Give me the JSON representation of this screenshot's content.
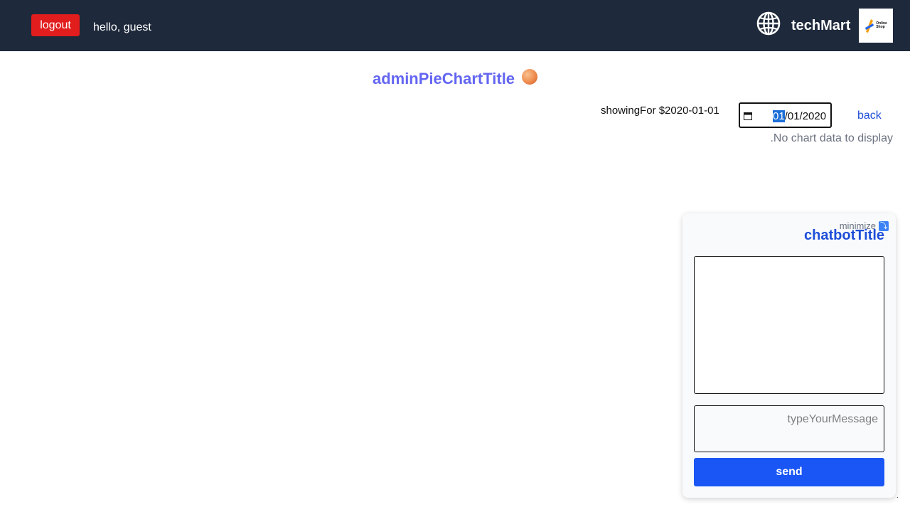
{
  "header": {
    "logout_label": "logout",
    "greeting": "hello, guest",
    "brand": "techMart",
    "logo_text_line1": "Online",
    "logo_text_line2": "Shop",
    "globe_icon": "globe-icon"
  },
  "main": {
    "title": "adminPieChartTitle",
    "title_icon": "ball-icon",
    "showing_for": "showingFor $2020-01-01",
    "date": {
      "day_segment": "01",
      "rest": "/01/2020"
    },
    "back_label": "back",
    "no_data": ".No chart data to display"
  },
  "chatbot": {
    "minimize_label": "minimize",
    "minimize_icon": "minimize-icon",
    "title": "chatbotTitle",
    "input_placeholder": "typeYourMessage",
    "send_label": "send"
  },
  "colors": {
    "header_bg": "#1e293b",
    "logout_bg": "#e11d1d",
    "title_color": "#6366f1",
    "link_color": "#1d4ed8",
    "send_bg": "#1a56f5"
  }
}
